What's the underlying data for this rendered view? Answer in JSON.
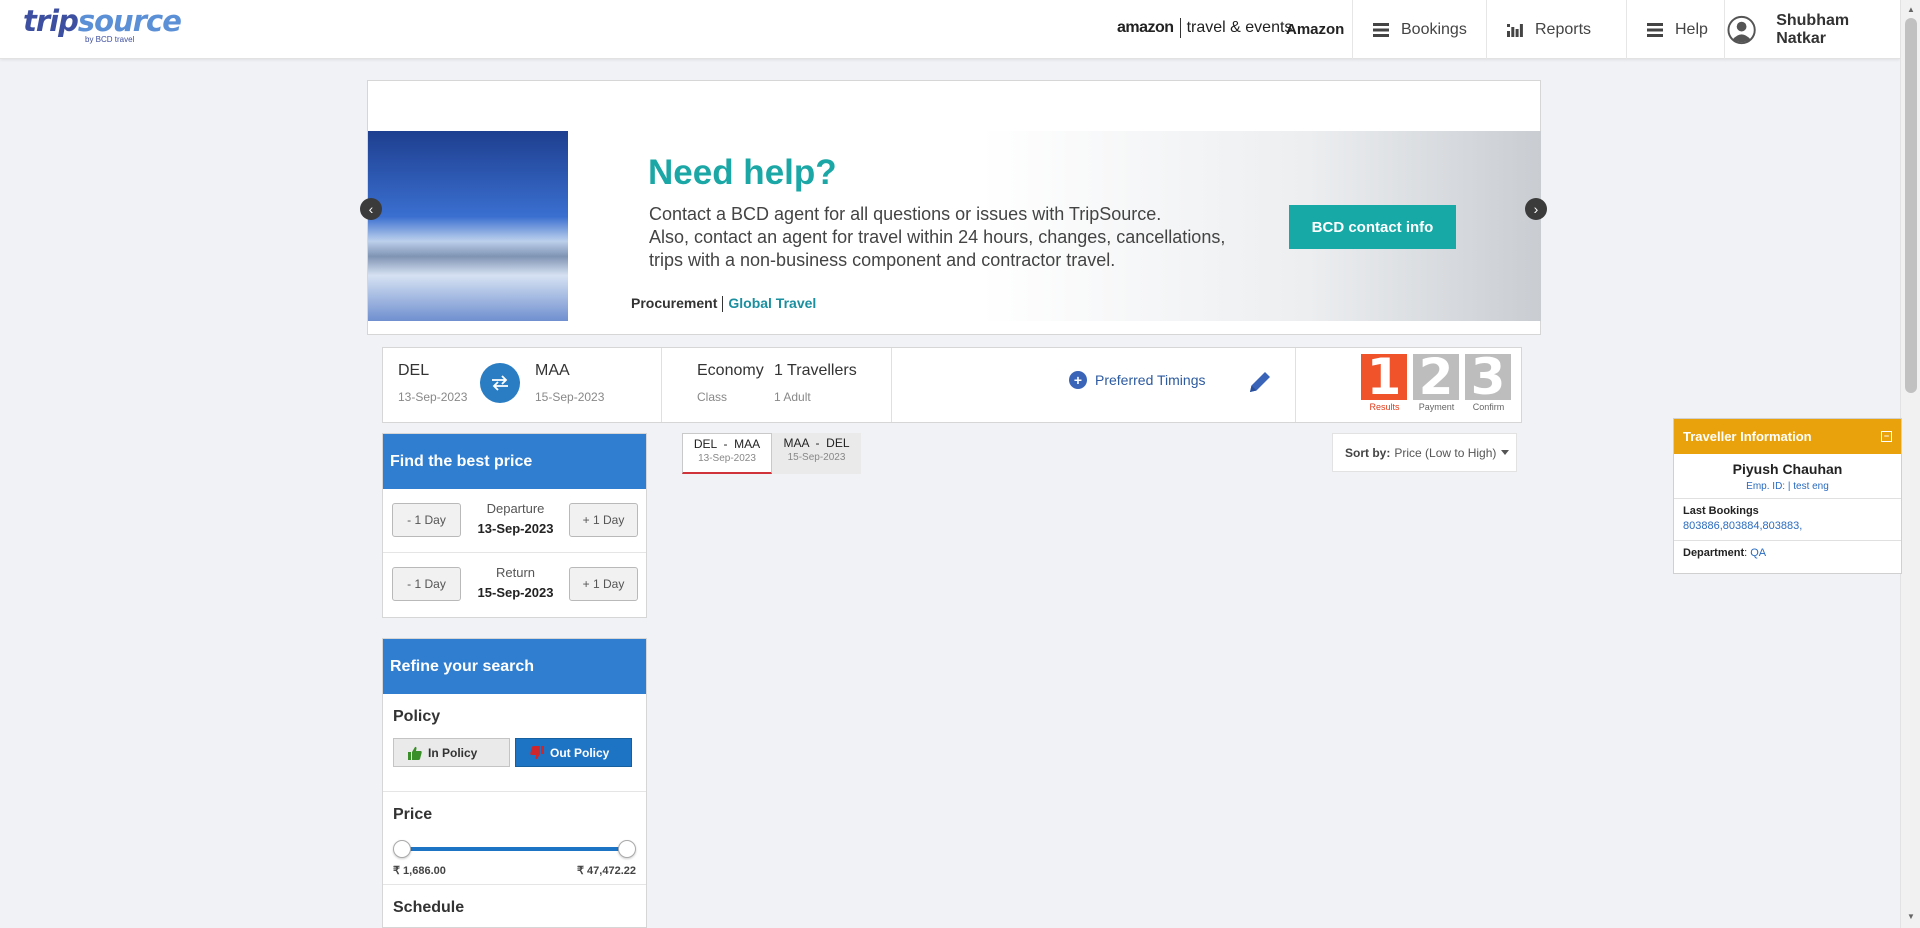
{
  "header": {
    "logo_text_a": "trip",
    "logo_text_b": "source",
    "logo_sub": "by BCD travel",
    "amazon_brand": "amazon",
    "amazon_text": "travel & events",
    "company": "Amazon",
    "nav": [
      {
        "label": "Bookings",
        "icon": "list-icon"
      },
      {
        "label": "Reports",
        "icon": "bar-chart-icon"
      },
      {
        "label": "Help",
        "icon": "list-icon"
      }
    ],
    "user_name": "Shubham Natkar"
  },
  "banner": {
    "title": "Need help?",
    "line1": "Contact a BCD agent for all questions or issues with TripSource.",
    "line2": "Also, contact an agent for travel within 24 hours, changes, cancellations,",
    "line3": "trips with a non-business component and contractor travel.",
    "button": "BCD contact info",
    "footer_a": "Procurement",
    "footer_b": "Global Travel",
    "prev": "‹",
    "next": "›"
  },
  "summary": {
    "from_city": "DEL",
    "from_date": "13-Sep-2023",
    "to_city": "MAA",
    "to_date": "15-Sep-2023",
    "class_value": "Economy",
    "class_label": "Class",
    "travellers_value": "1 Travellers",
    "travellers_label": "1 Adult",
    "preferred_timings": "Preferred Timings",
    "steps": [
      {
        "num": "1",
        "label": "Results",
        "color": "#f0522a"
      },
      {
        "num": "2",
        "label": "Payment",
        "color": "#bdbdbd"
      },
      {
        "num": "3",
        "label": "Confirm",
        "color": "#bdbdbd"
      }
    ]
  },
  "best_price": {
    "title": "Find the best price",
    "minus": "- 1 Day",
    "plus": "+ 1 Day",
    "departure_label": "Departure",
    "departure_date": "13-Sep-2023",
    "return_label": "Return",
    "return_date": "15-Sep-2023"
  },
  "refine": {
    "title": "Refine your search",
    "policy_title": "Policy",
    "in_policy": "In Policy",
    "out_policy": "Out Policy",
    "price_title": "Price",
    "price_min": "₹ 1,686.00",
    "price_max": "₹ 47,472.22",
    "schedule_title": "Schedule"
  },
  "routes": [
    {
      "route": "DEL  -  MAA",
      "date": "13-Sep-2023",
      "active": true
    },
    {
      "route": "MAA  -  DEL",
      "date": "15-Sep-2023",
      "active": false
    }
  ],
  "sort": {
    "label": "Sort by:",
    "value": "Price (Low to High)"
  },
  "traveller": {
    "title": "Traveller Information",
    "name": "Piyush Chauhan",
    "emp": "Emp. ID: | test eng",
    "last_bookings_label": "Last Bookings",
    "last_bookings": "803886,803884,803883,",
    "department_label": "Department",
    "department": "QA"
  }
}
